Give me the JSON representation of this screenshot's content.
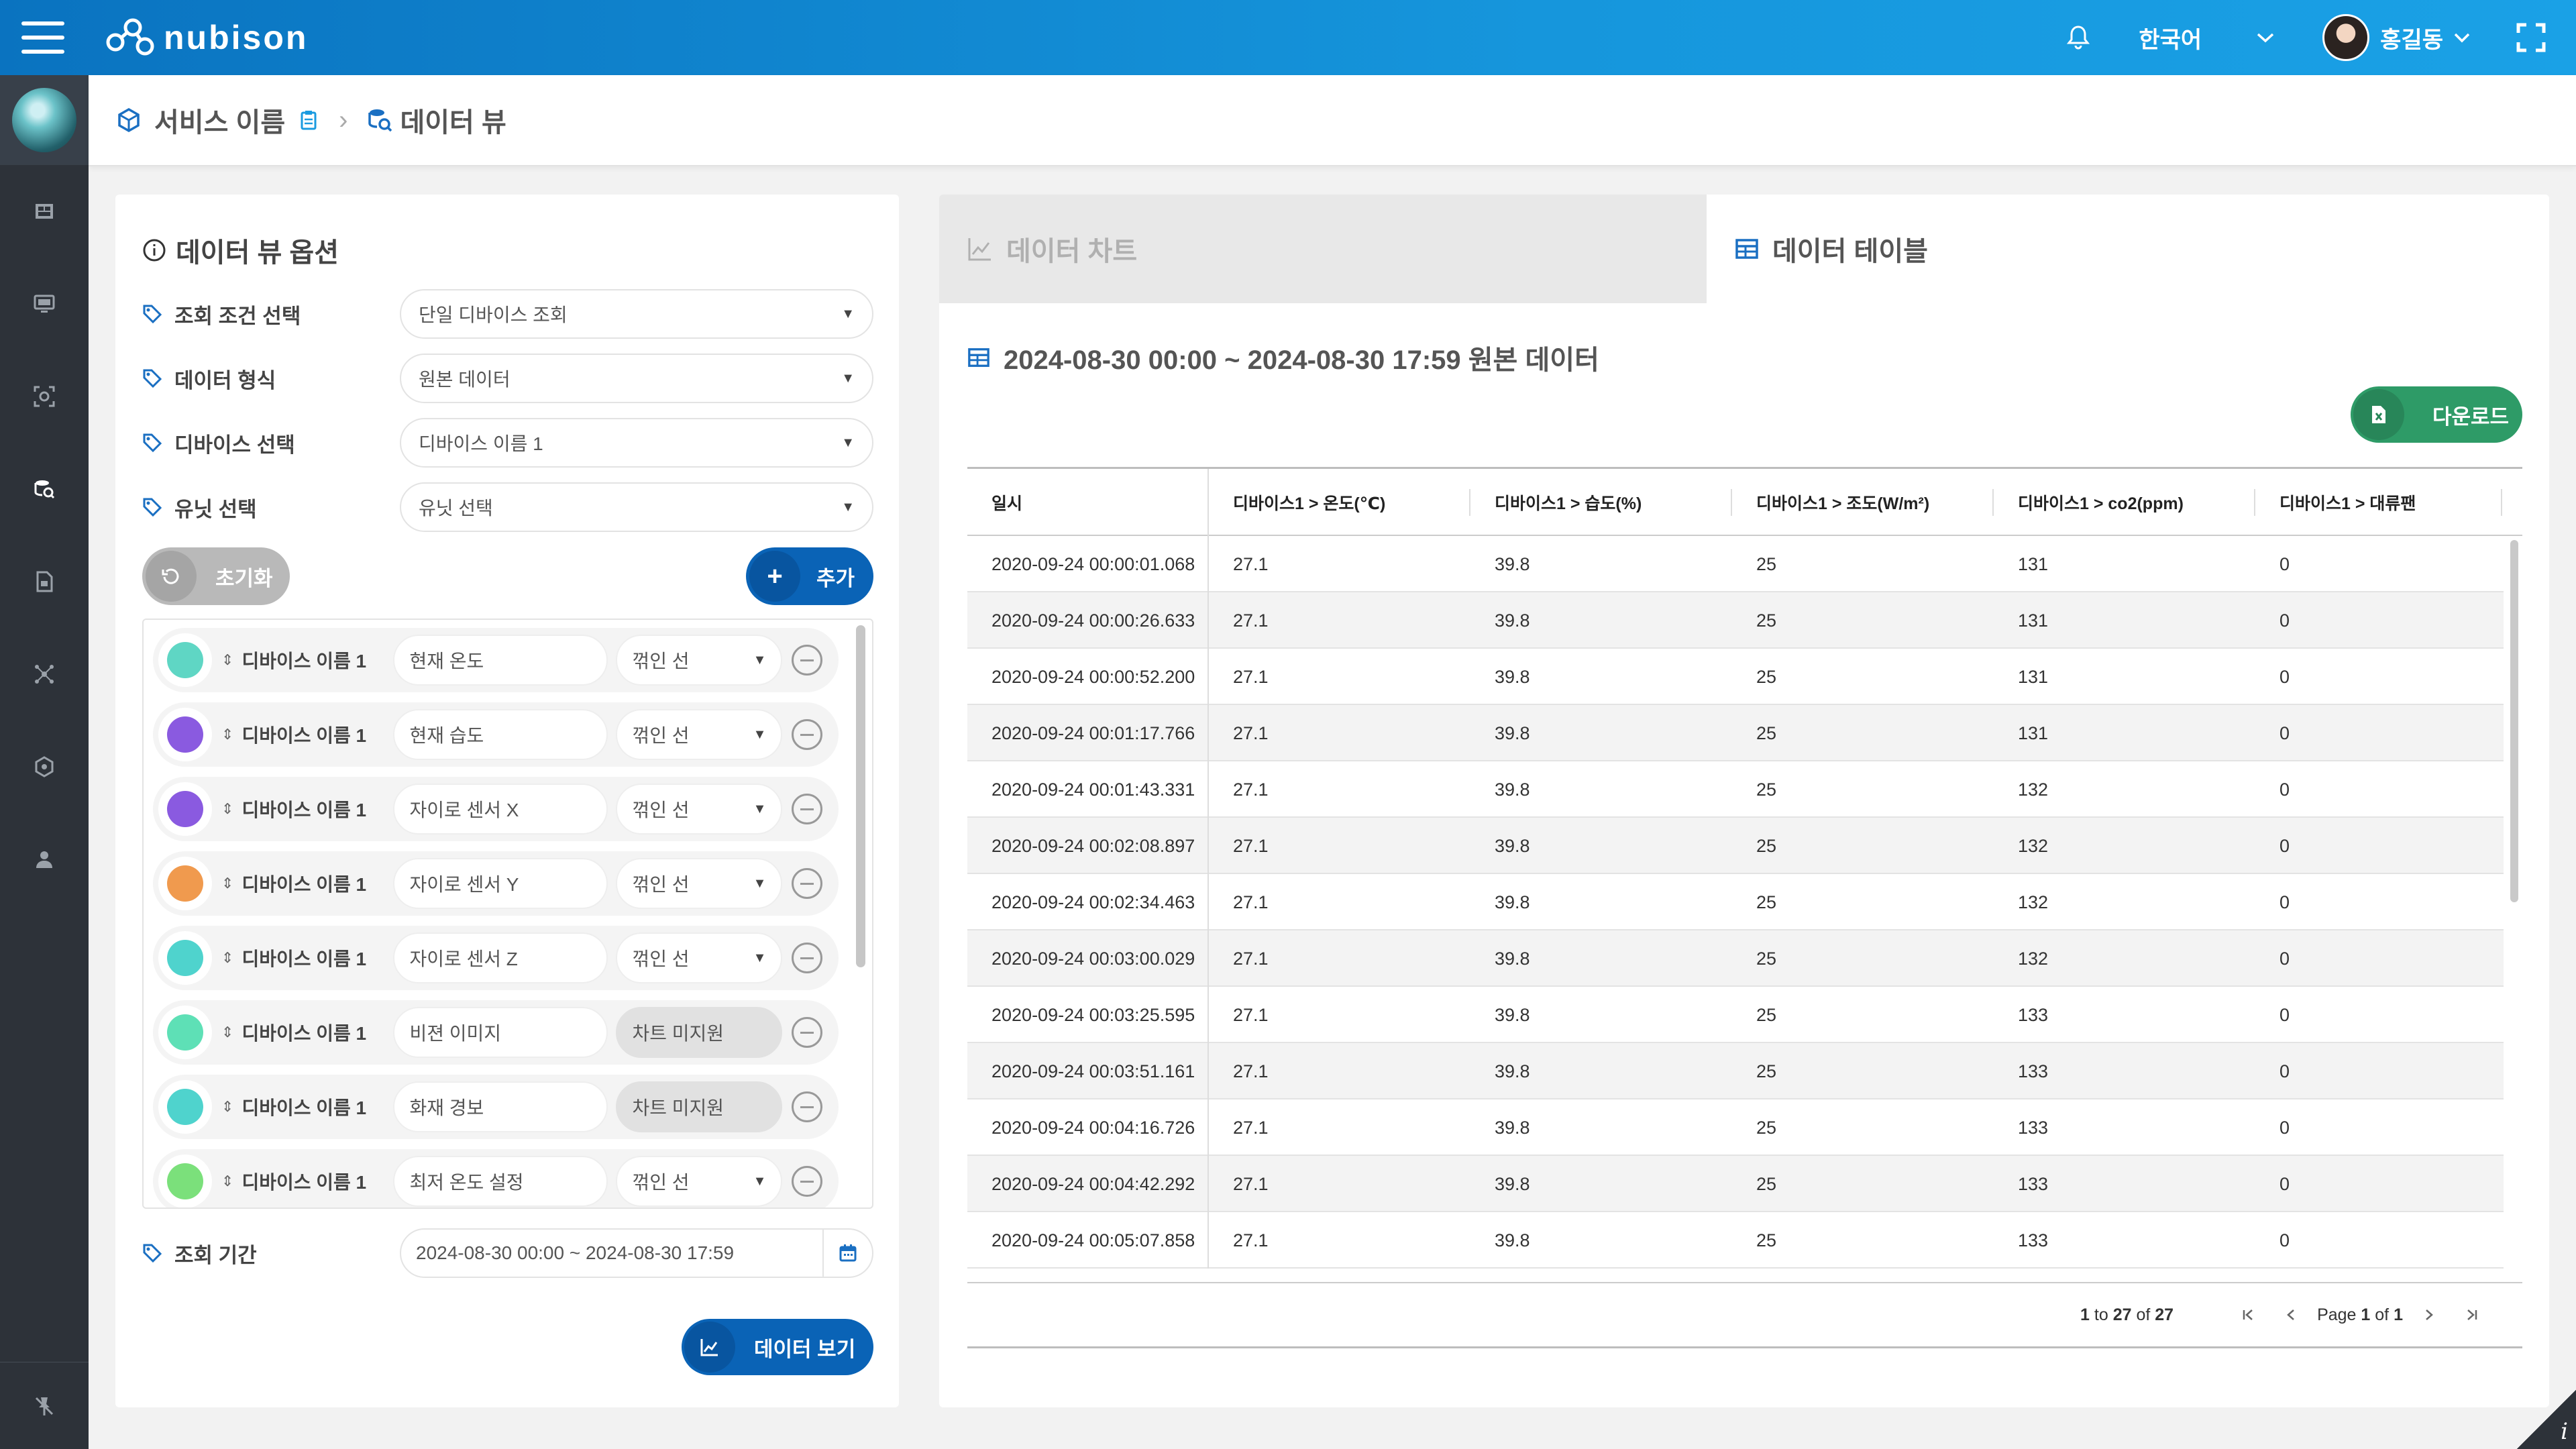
{
  "topbar": {
    "logo": "nubison",
    "language": "한국어",
    "username": "홍길동"
  },
  "sidebar": {
    "items": [
      "dashboard-icon",
      "monitor-icon",
      "scan-icon",
      "data-search-icon",
      "document-icon",
      "network-icon",
      "cube-icon",
      "user-icon"
    ],
    "active": "data-search-icon"
  },
  "breadcrumb": {
    "service": "서비스 이름",
    "page": "데이터 뷰"
  },
  "options": {
    "title": "데이터 뷰 옵션",
    "query_condition": {
      "label": "조회 조건 선택",
      "value": "단일 디바이스 조회"
    },
    "data_format": {
      "label": "데이터 형식",
      "value": "원본 데이터"
    },
    "device": {
      "label": "디바이스 선택",
      "value": "디바이스 이름 1"
    },
    "unit": {
      "label": "유닛 선택",
      "value": "유닛 선택"
    },
    "reset_label": "초기화",
    "add_label": "추가",
    "items": [
      {
        "color": "#5fd6c4",
        "device": "디바이스 이름 1",
        "name": "현재 온도",
        "type": "꺾인 선",
        "supported": true
      },
      {
        "color": "#8a5ae0",
        "device": "디바이스 이름 1",
        "name": "현재 습도",
        "type": "꺾인 선",
        "supported": true
      },
      {
        "color": "#8a5ae0",
        "device": "디바이스 이름 1",
        "name": "자이로 센서 X",
        "type": "꺾인 선",
        "supported": true
      },
      {
        "color": "#f09a4e",
        "device": "디바이스 이름 1",
        "name": "자이로 센서 Y",
        "type": "꺾인 선",
        "supported": true
      },
      {
        "color": "#4fd3cd",
        "device": "디바이스 이름 1",
        "name": "자이로 센서 Z",
        "type": "꺾인 선",
        "supported": true
      },
      {
        "color": "#5ee0b6",
        "device": "디바이스 이름 1",
        "name": "비젼 이미지",
        "type": "차트 미지원",
        "supported": false
      },
      {
        "color": "#4fd3cd",
        "device": "디바이스 이름 1",
        "name": "화재 경보",
        "type": "차트 미지원",
        "supported": false
      },
      {
        "color": "#7be07b",
        "device": "디바이스 이름 1",
        "name": "최저 온도 설정",
        "type": "꺾인 선",
        "supported": true
      }
    ],
    "period": {
      "label": "조회 기간",
      "value": "2024-08-30 00:00 ~ 2024-08-30 17:59"
    },
    "view_label": "데이터 보기"
  },
  "tabs": {
    "chart": "데이터 차트",
    "table": "데이터 테이블"
  },
  "table": {
    "title": "2024-08-30 00:00 ~ 2024-08-30 17:59 원본 데이터",
    "download_label": "다운로드",
    "columns": [
      "일시",
      "디바이스1 > 온도(℃)",
      "디바이스1 > 습도(%)",
      "디바이스1 > 조도(W/m²)",
      "디바이스1 > co2(ppm)",
      "디바이스1 > 대류팬"
    ],
    "rows": [
      [
        "2020-09-24 00:00:01.068",
        "27.1",
        "39.8",
        "25",
        "131",
        "0"
      ],
      [
        "2020-09-24 00:00:26.633",
        "27.1",
        "39.8",
        "25",
        "131",
        "0"
      ],
      [
        "2020-09-24 00:00:52.200",
        "27.1",
        "39.8",
        "25",
        "131",
        "0"
      ],
      [
        "2020-09-24 00:01:17.766",
        "27.1",
        "39.8",
        "25",
        "131",
        "0"
      ],
      [
        "2020-09-24 00:01:43.331",
        "27.1",
        "39.8",
        "25",
        "132",
        "0"
      ],
      [
        "2020-09-24 00:02:08.897",
        "27.1",
        "39.8",
        "25",
        "132",
        "0"
      ],
      [
        "2020-09-24 00:02:34.463",
        "27.1",
        "39.8",
        "25",
        "132",
        "0"
      ],
      [
        "2020-09-24 00:03:00.029",
        "27.1",
        "39.8",
        "25",
        "132",
        "0"
      ],
      [
        "2020-09-24 00:03:25.595",
        "27.1",
        "39.8",
        "25",
        "133",
        "0"
      ],
      [
        "2020-09-24 00:03:51.161",
        "27.1",
        "39.8",
        "25",
        "133",
        "0"
      ],
      [
        "2020-09-24 00:04:16.726",
        "27.1",
        "39.8",
        "25",
        "133",
        "0"
      ],
      [
        "2020-09-24 00:04:42.292",
        "27.1",
        "39.8",
        "25",
        "133",
        "0"
      ],
      [
        "2020-09-24 00:05:07.858",
        "27.1",
        "39.8",
        "25",
        "133",
        "0"
      ]
    ],
    "pagination": {
      "from": "1",
      "to_word": "to",
      "to": "27",
      "of_word": "of",
      "total": "27",
      "page_word": "Page",
      "page": "1",
      "pages": "1"
    }
  },
  "corner_icon": "info-icon"
}
